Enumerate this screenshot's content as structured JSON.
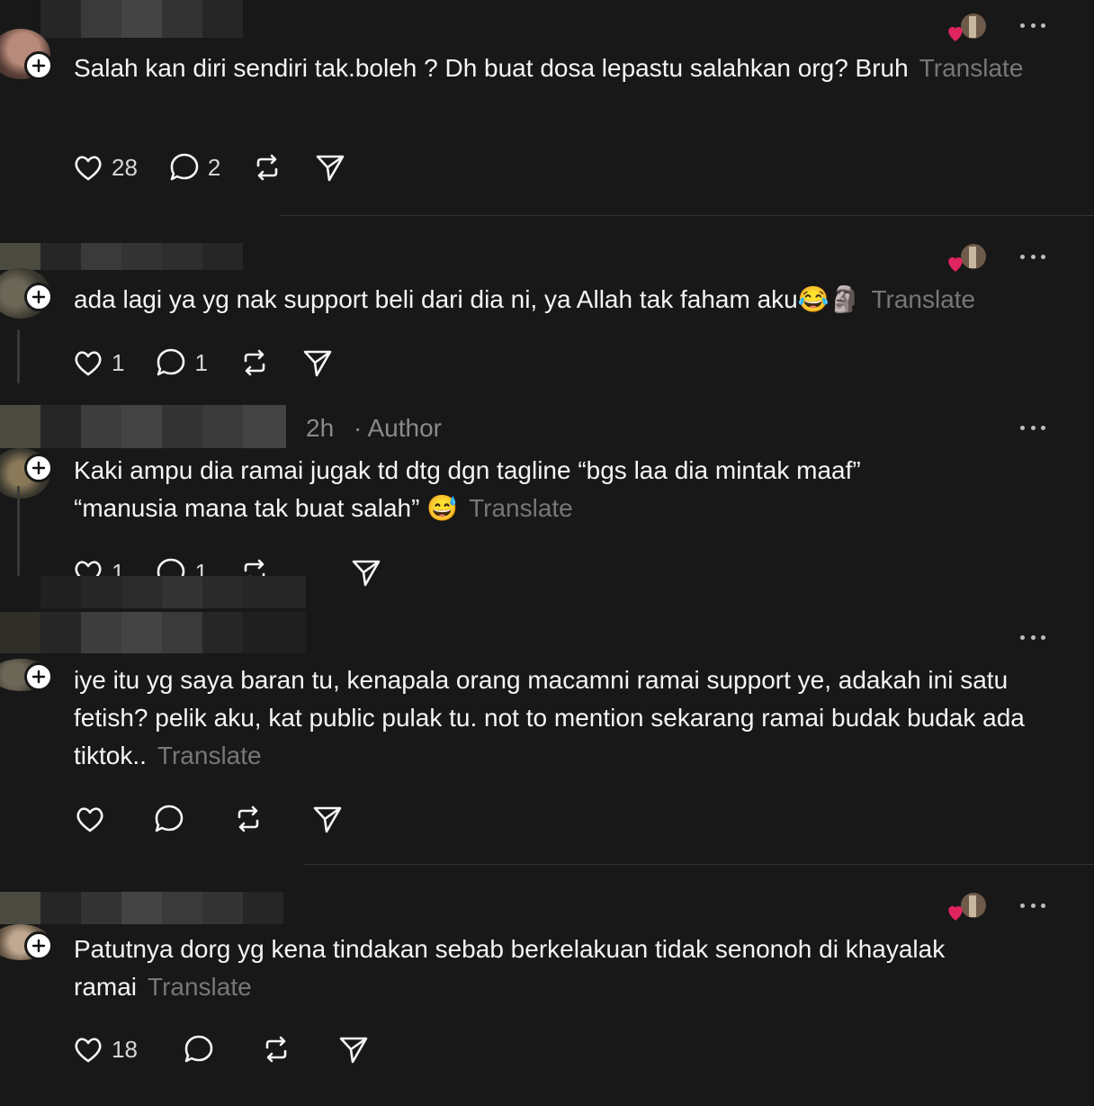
{
  "translate_label": "Translate",
  "posts": [
    {
      "text": "Salah kan diri sendiri tak.boleh ? Dh buat dosa lepastu salahkan org? Bruh",
      "likes": "28",
      "replies": "2",
      "author_liked": true
    },
    {
      "text": "ada lagi ya yg nak support beli dari dia ni, ya Allah tak faham aku😂🗿",
      "likes": "1",
      "replies": "1",
      "author_liked": true
    },
    {
      "text": "Kaki ampu dia ramai jugak td dtg dgn tagline “bgs laa dia mintak maaf” “manusia mana tak buat salah” 😅",
      "time": "2h",
      "author_label": "· Author",
      "likes": "1",
      "replies": "1"
    },
    {
      "text": "iye itu yg saya baran tu, kenapala orang macamni ramai support ye, adakah ini satu fetish? pelik aku, kat public pulak tu. not to mention sekarang ramai budak budak ada tiktok..",
      "likes": "",
      "replies": ""
    },
    {
      "text": "Patutnya dorg yg kena tindakan sebab berkelakuan tidak senonoh di khayalak ramai",
      "likes": "18",
      "replies": "",
      "author_liked": true
    }
  ],
  "colors": {
    "background": "#181818",
    "text": "#f3f5f7",
    "muted": "#777777",
    "heart": "#e0245e"
  }
}
